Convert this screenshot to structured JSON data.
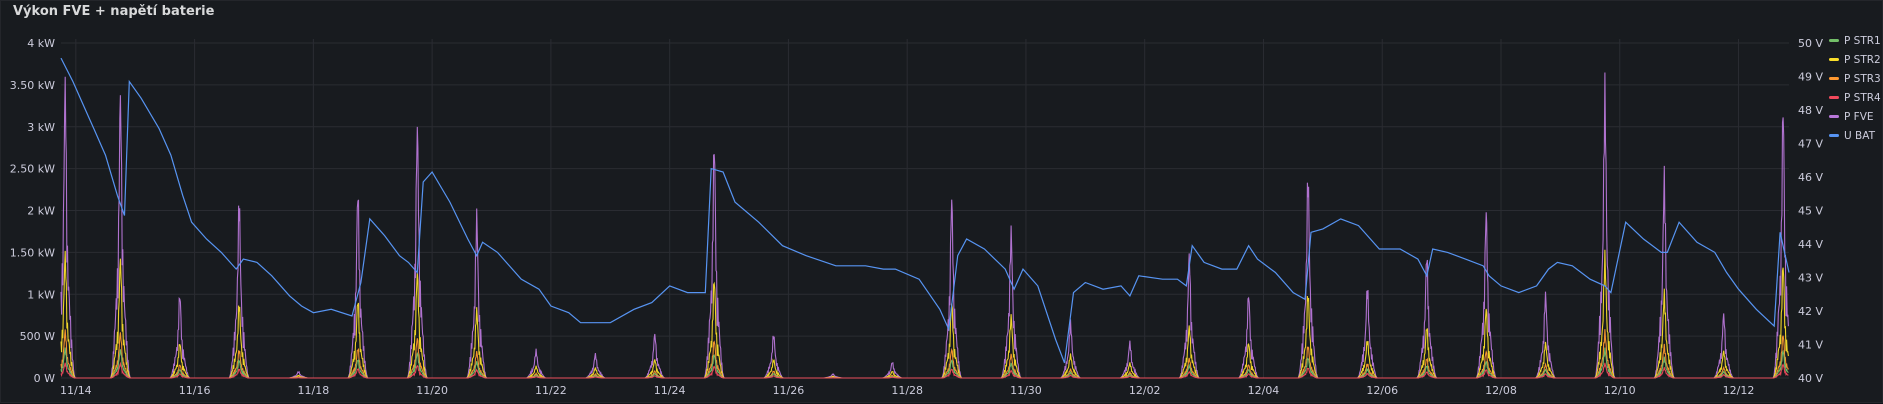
{
  "panel": {
    "title": "Výkon FVE + napětí baterie"
  },
  "chart_data": {
    "type": "line",
    "title": "Výkon FVE + napětí baterie",
    "x_range_days": [
      13.75,
      42.85
    ],
    "x_ticks": [
      {
        "day": 14,
        "label": "11/14"
      },
      {
        "day": 16,
        "label": "11/16"
      },
      {
        "day": 18,
        "label": "11/18"
      },
      {
        "day": 20,
        "label": "11/20"
      },
      {
        "day": 22,
        "label": "11/22"
      },
      {
        "day": 24,
        "label": "11/24"
      },
      {
        "day": 26,
        "label": "11/26"
      },
      {
        "day": 28,
        "label": "11/28"
      },
      {
        "day": 30,
        "label": "11/30"
      },
      {
        "day": 32,
        "label": "12/02"
      },
      {
        "day": 34,
        "label": "12/04"
      },
      {
        "day": 36,
        "label": "12/06"
      },
      {
        "day": 38,
        "label": "12/08"
      },
      {
        "day": 40,
        "label": "12/10"
      },
      {
        "day": 42,
        "label": "12/12"
      }
    ],
    "y_left": {
      "unit": "kW",
      "range": [
        0,
        4
      ],
      "ticks": [
        {
          "v": 0,
          "label": "0 W"
        },
        {
          "v": 0.5,
          "label": "500 W"
        },
        {
          "v": 1,
          "label": "1 kW"
        },
        {
          "v": 1.5,
          "label": "1.50 kW"
        },
        {
          "v": 2,
          "label": "2 kW"
        },
        {
          "v": 2.5,
          "label": "2.50 kW"
        },
        {
          "v": 3,
          "label": "3 kW"
        },
        {
          "v": 3.5,
          "label": "3.50 kW"
        },
        {
          "v": 4,
          "label": "4 kW"
        }
      ]
    },
    "y_right": {
      "unit": "V",
      "range": [
        40,
        50
      ],
      "ticks": [
        {
          "v": 40,
          "label": "40 V"
        },
        {
          "v": 41,
          "label": "41 V"
        },
        {
          "v": 42,
          "label": "42 V"
        },
        {
          "v": 43,
          "label": "43 V"
        },
        {
          "v": 44,
          "label": "44 V"
        },
        {
          "v": 45,
          "label": "45 V"
        },
        {
          "v": 46,
          "label": "46 V"
        },
        {
          "v": 47,
          "label": "47 V"
        },
        {
          "v": 48,
          "label": "48 V"
        },
        {
          "v": 49,
          "label": "49 V"
        },
        {
          "v": 50,
          "label": "50 V"
        }
      ]
    },
    "grid": true,
    "legend_placement": "right",
    "series_meta": [
      {
        "name": "P STR1",
        "color": "#73bf69",
        "axis": "left"
      },
      {
        "name": "P STR2",
        "color": "#fade2a",
        "axis": "left"
      },
      {
        "name": "P STR3",
        "color": "#ff9830",
        "axis": "left"
      },
      {
        "name": "P STR4",
        "color": "#f2495c",
        "axis": "left"
      },
      {
        "name": "P FVE",
        "color": "#b877d9",
        "axis": "left"
      },
      {
        "name": "U BAT",
        "color": "#5794f2",
        "axis": "right"
      }
    ],
    "solar_days": [
      {
        "day": 13.82,
        "peak_kw": 3.7
      },
      {
        "day": 14.75,
        "peak_kw": 3.55
      },
      {
        "day": 15.75,
        "peak_kw": 1.05
      },
      {
        "day": 16.75,
        "peak_kw": 2.25
      },
      {
        "day": 17.75,
        "peak_kw": 0.08
      },
      {
        "day": 18.75,
        "peak_kw": 2.35
      },
      {
        "day": 19.75,
        "peak_kw": 3.15
      },
      {
        "day": 20.75,
        "peak_kw": 2.05
      },
      {
        "day": 21.75,
        "peak_kw": 0.35
      },
      {
        "day": 22.75,
        "peak_kw": 0.3
      },
      {
        "day": 23.75,
        "peak_kw": 0.55
      },
      {
        "day": 24.75,
        "peak_kw": 2.95
      },
      {
        "day": 25.75,
        "peak_kw": 0.55
      },
      {
        "day": 26.75,
        "peak_kw": 0.05
      },
      {
        "day": 27.75,
        "peak_kw": 0.2
      },
      {
        "day": 28.75,
        "peak_kw": 2.25
      },
      {
        "day": 29.75,
        "peak_kw": 1.85
      },
      {
        "day": 30.75,
        "peak_kw": 0.7
      },
      {
        "day": 31.75,
        "peak_kw": 0.45
      },
      {
        "day": 32.75,
        "peak_kw": 1.55
      },
      {
        "day": 33.75,
        "peak_kw": 1.05
      },
      {
        "day": 34.75,
        "peak_kw": 2.55
      },
      {
        "day": 35.75,
        "peak_kw": 1.15
      },
      {
        "day": 36.75,
        "peak_kw": 1.55
      },
      {
        "day": 37.75,
        "peak_kw": 2.1
      },
      {
        "day": 38.75,
        "peak_kw": 1.05
      },
      {
        "day": 39.75,
        "peak_kw": 3.65
      },
      {
        "day": 40.75,
        "peak_kw": 2.55
      },
      {
        "day": 41.75,
        "peak_kw": 0.8
      },
      {
        "day": 42.75,
        "peak_kw": 3.4
      }
    ],
    "u_bat": {
      "x_days": [
        13.75,
        13.95,
        14.1,
        14.3,
        14.5,
        14.7,
        14.82,
        14.9,
        15.1,
        15.4,
        15.6,
        15.8,
        15.95,
        16.2,
        16.45,
        16.7,
        16.82,
        17.05,
        17.3,
        17.6,
        17.8,
        18.0,
        18.3,
        18.65,
        18.8,
        18.95,
        19.2,
        19.45,
        19.6,
        19.75,
        19.85,
        20.0,
        20.3,
        20.6,
        20.75,
        20.85,
        21.1,
        21.5,
        21.8,
        22.0,
        22.3,
        22.5,
        22.8,
        23.0,
        23.4,
        23.7,
        24.0,
        24.3,
        24.6,
        24.7,
        24.9,
        25.1,
        25.5,
        25.9,
        26.3,
        26.8,
        27.3,
        27.6,
        27.8,
        28.2,
        28.55,
        28.7,
        28.85,
        29.0,
        29.3,
        29.65,
        29.8,
        29.95,
        30.2,
        30.5,
        30.65,
        30.8,
        31.0,
        31.3,
        31.6,
        31.75,
        31.9,
        32.3,
        32.55,
        32.7,
        32.8,
        33.0,
        33.3,
        33.55,
        33.75,
        33.9,
        34.2,
        34.5,
        34.7,
        34.8,
        35.0,
        35.3,
        35.6,
        35.8,
        35.95,
        36.3,
        36.6,
        36.75,
        36.85,
        37.1,
        37.4,
        37.7,
        37.8,
        38.0,
        38.3,
        38.6,
        38.8,
        38.95,
        39.2,
        39.5,
        39.75,
        39.85,
        40.1,
        40.4,
        40.7,
        40.8,
        41.0,
        41.3,
        41.6,
        41.8,
        42.0,
        42.3,
        42.6,
        42.7,
        42.85
      ],
      "volts": [
        49.5,
        48.9,
        48.2,
        47.5,
        46.6,
        45.5,
        44.8,
        48.9,
        48.3,
        47.5,
        46.6,
        45.5,
        44.6,
        44.2,
        43.7,
        43.3,
        43.5,
        43.5,
        43.0,
        42.5,
        42.1,
        42.0,
        42.0,
        41.9,
        42.8,
        44.8,
        44.2,
        43.7,
        43.4,
        43.2,
        45.8,
        46.2,
        45.2,
        44.2,
        43.6,
        44.1,
        43.7,
        43.0,
        42.6,
        42.2,
        41.9,
        41.7,
        41.6,
        41.7,
        42.0,
        42.3,
        42.7,
        42.6,
        42.5,
        46.3,
        46.1,
        45.3,
        44.6,
        44.0,
        43.6,
        43.4,
        43.3,
        43.3,
        43.2,
        43.0,
        42.0,
        41.5,
        43.6,
        44.2,
        43.8,
        43.3,
        42.6,
        43.3,
        42.7,
        41.2,
        40.4,
        42.6,
        42.8,
        42.7,
        42.7,
        42.5,
        43.0,
        43.0,
        42.9,
        42.8,
        43.9,
        43.5,
        43.2,
        43.3,
        43.9,
        43.6,
        43.1,
        42.6,
        42.3,
        44.4,
        44.4,
        44.8,
        44.5,
        44.2,
        43.8,
        43.9,
        43.5,
        43.1,
        43.8,
        43.8,
        43.5,
        43.4,
        43.0,
        42.8,
        42.5,
        42.8,
        43.2,
        43.5,
        43.3,
        43.0,
        42.7,
        42.6,
        44.6,
        44.2,
        43.7,
        43.8,
        44.6,
        44.1,
        43.7,
        43.2,
        42.6,
        42.1,
        41.5,
        44.4,
        43.1
      ]
    }
  }
}
